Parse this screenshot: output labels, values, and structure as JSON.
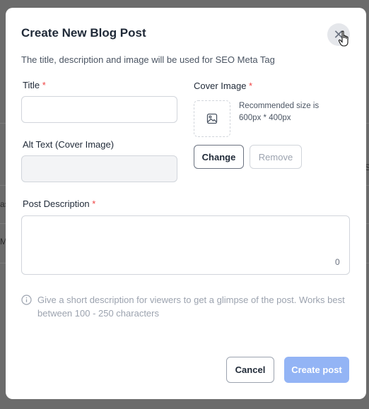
{
  "background": {
    "fragments": [
      "as",
      "Ma",
      "S"
    ]
  },
  "modal": {
    "title": "Create New Blog Post",
    "subtitle": "The title, description and image will be used for SEO Meta Tag",
    "close_icon": "close-icon",
    "required_mark": "*",
    "fields": {
      "title_label": "Title",
      "title_value": "",
      "alt_text_label": "Alt Text (Cover Image)",
      "alt_text_value": "",
      "cover_image_label": "Cover Image",
      "cover_image_hint": "Recommended size is 600px * 400px",
      "description_label": "Post Description",
      "description_value": "",
      "description_count": "0"
    },
    "buttons": {
      "change": "Change",
      "remove": "Remove",
      "cancel": "Cancel",
      "create": "Create post"
    },
    "hint": "Give a short description for viewers to get a glimpse of the post. Works best between 100 - 250 characters",
    "colors": {
      "primary_disabled": "#93b4f5",
      "required": "#ef4444"
    }
  }
}
